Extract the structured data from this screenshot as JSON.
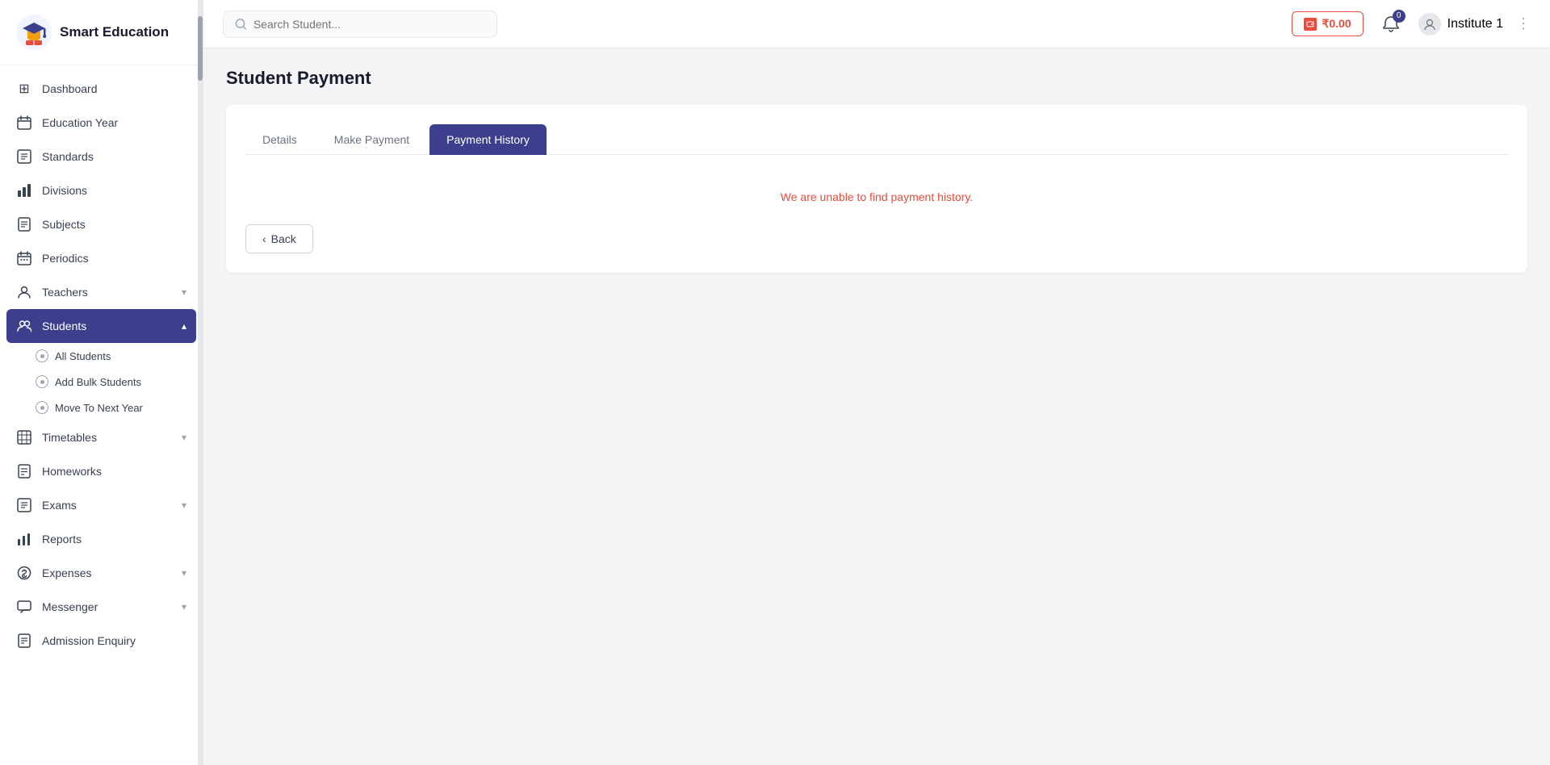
{
  "app": {
    "name": "Smart Education"
  },
  "topbar": {
    "search_placeholder": "Search Student...",
    "balance": "₹0.00",
    "notification_count": "0",
    "user_name": "Institute 1",
    "more_icon": "⋮"
  },
  "sidebar": {
    "nav_items": [
      {
        "id": "dashboard",
        "label": "Dashboard",
        "icon": "⊞",
        "has_chevron": false
      },
      {
        "id": "education-year",
        "label": "Education Year",
        "icon": "📅",
        "has_chevron": false
      },
      {
        "id": "standards",
        "label": "Standards",
        "icon": "📋",
        "has_chevron": false
      },
      {
        "id": "divisions",
        "label": "Divisions",
        "icon": "📊",
        "has_chevron": false
      },
      {
        "id": "subjects",
        "label": "Subjects",
        "icon": "📚",
        "has_chevron": false
      },
      {
        "id": "periodics",
        "label": "Periodics",
        "icon": "📆",
        "has_chevron": false
      },
      {
        "id": "teachers",
        "label": "Teachers",
        "icon": "👤",
        "has_chevron": true
      },
      {
        "id": "students",
        "label": "Students",
        "icon": "👥",
        "has_chevron": true,
        "active": true
      },
      {
        "id": "timetables",
        "label": "Timetables",
        "icon": "📅",
        "has_chevron": true
      },
      {
        "id": "homeworks",
        "label": "Homeworks",
        "icon": "📝",
        "has_chevron": false
      },
      {
        "id": "exams",
        "label": "Exams",
        "icon": "📋",
        "has_chevron": true
      },
      {
        "id": "reports",
        "label": "Reports",
        "icon": "📈",
        "has_chevron": false
      },
      {
        "id": "expenses",
        "label": "Expenses",
        "icon": "💳",
        "has_chevron": true
      },
      {
        "id": "messenger",
        "label": "Messenger",
        "icon": "💬",
        "has_chevron": true
      },
      {
        "id": "admission-enquiry",
        "label": "Admission Enquiry",
        "icon": "📋",
        "has_chevron": false
      }
    ],
    "sub_items": [
      {
        "id": "all-students",
        "label": "All Students"
      },
      {
        "id": "add-bulk-students",
        "label": "Add Bulk Students"
      },
      {
        "id": "move-to-next-year",
        "label": "Move To Next Year"
      }
    ]
  },
  "page": {
    "title": "Student Payment",
    "tabs": [
      {
        "id": "details",
        "label": "Details",
        "active": false
      },
      {
        "id": "make-payment",
        "label": "Make Payment",
        "active": false
      },
      {
        "id": "payment-history",
        "label": "Payment History",
        "active": true
      }
    ],
    "empty_message": "We are unable to find payment history.",
    "back_button": "‹ Back"
  }
}
